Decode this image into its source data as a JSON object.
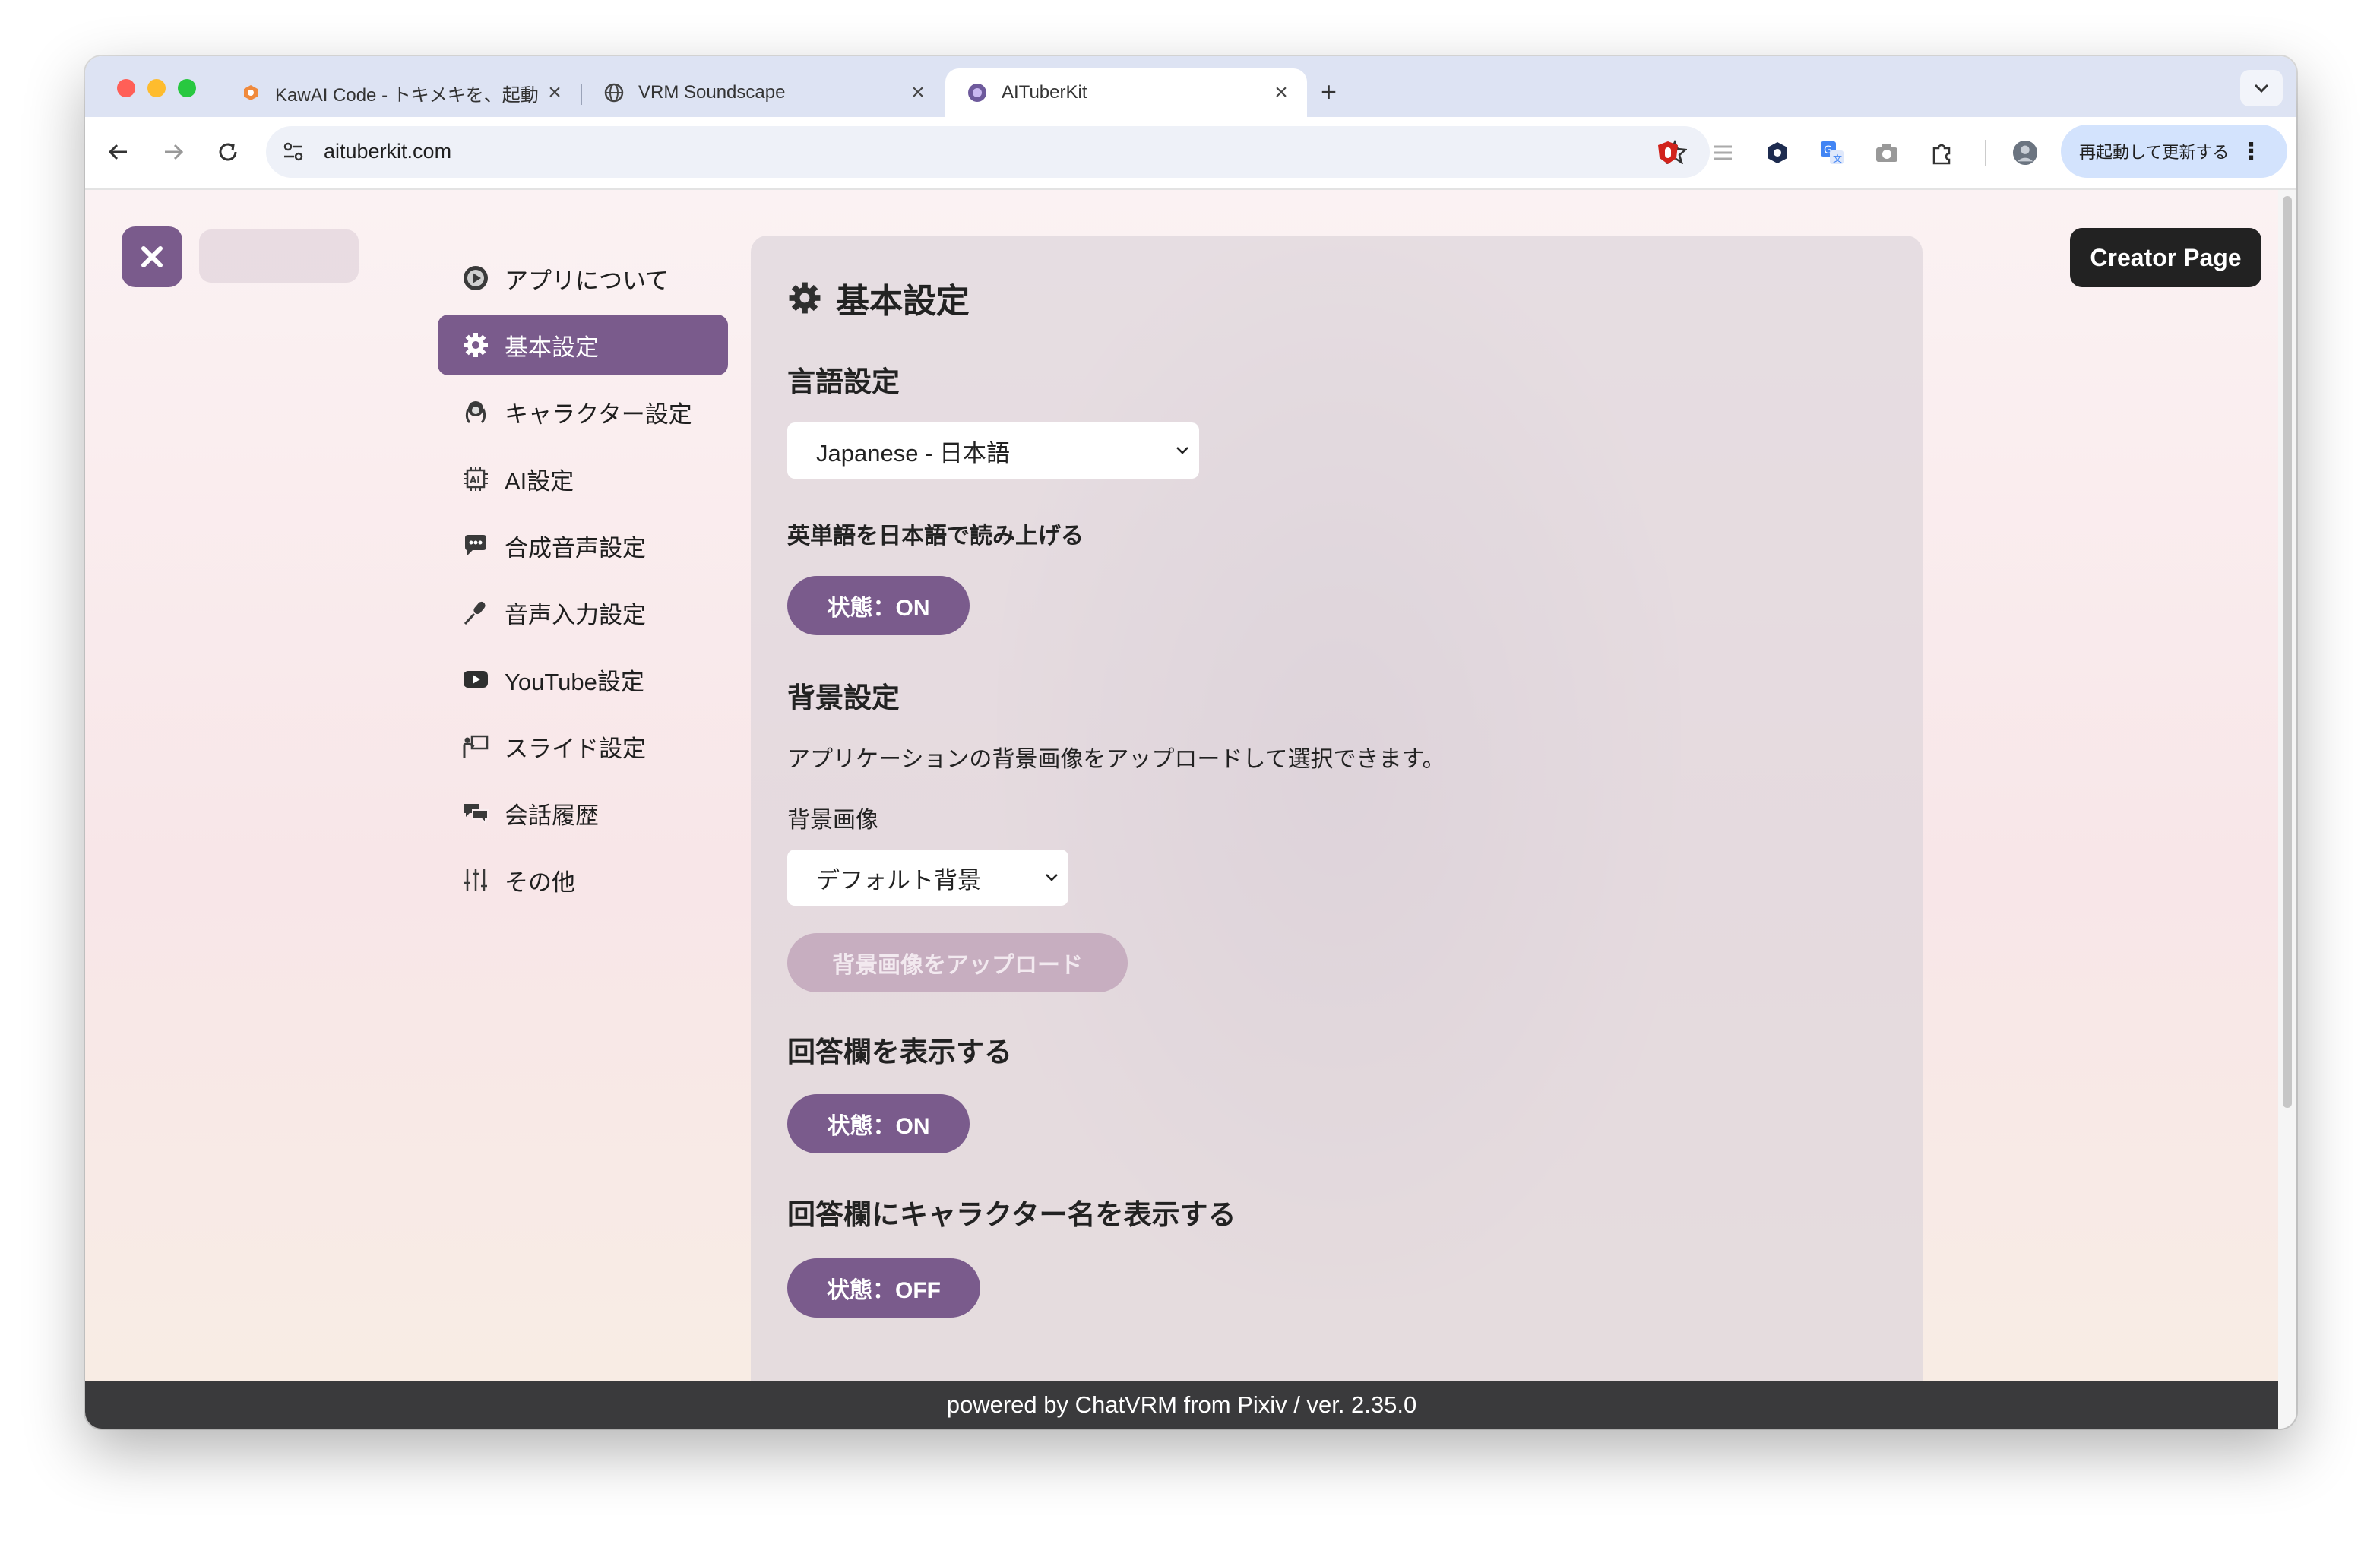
{
  "browser": {
    "tabs": [
      {
        "title": "KawAI Code - トキメキを、起動",
        "active": false
      },
      {
        "title": "VRM Soundscape",
        "active": false
      },
      {
        "title": "AITuberKit",
        "active": true
      }
    ],
    "url": "aituberkit.com",
    "restart_label": "再起動して更新する"
  },
  "header": {
    "creator_page_label": "Creator Page"
  },
  "sidebar": {
    "items": [
      {
        "label": "アプリについて",
        "icon": "play-circle-icon",
        "active": false
      },
      {
        "label": "基本設定",
        "icon": "gear-icon",
        "active": true
      },
      {
        "label": "キャラクター設定",
        "icon": "character-icon",
        "active": false
      },
      {
        "label": "AI設定",
        "icon": "ai-chip-icon",
        "active": false
      },
      {
        "label": "合成音声設定",
        "icon": "speech-bubble-icon",
        "active": false
      },
      {
        "label": "音声入力設定",
        "icon": "microphone-icon",
        "active": false
      },
      {
        "label": "YouTube設定",
        "icon": "youtube-icon",
        "active": false
      },
      {
        "label": "スライド設定",
        "icon": "presentation-icon",
        "active": false
      },
      {
        "label": "会話履歴",
        "icon": "chat-history-icon",
        "active": false
      },
      {
        "label": "その他",
        "icon": "sliders-icon",
        "active": false
      }
    ]
  },
  "panel": {
    "title": "基本設定",
    "language": {
      "heading": "言語設定",
      "selected": "Japanese - 日本語"
    },
    "english_reading": {
      "heading": "英単語を日本語で読み上げる",
      "state": "状態：ON"
    },
    "background": {
      "heading": "背景設定",
      "description": "アプリケーションの背景画像をアップロードして選択できます。",
      "image_label": "背景画像",
      "selected": "デフォルト背景",
      "upload_label": "背景画像をアップロード"
    },
    "answer_box": {
      "heading": "回答欄を表示する",
      "state": "状態：ON"
    },
    "character_name": {
      "heading": "回答欄にキャラクター名を表示する",
      "state": "状態：OFF"
    }
  },
  "footer": {
    "text": "powered by ChatVRM from Pixiv / ver. 2.35.0"
  },
  "colors": {
    "accent": "#7a5b8c",
    "creator_button": "#222222",
    "footer": "#3a3a3c",
    "upload_disabled": "#c7aec0"
  }
}
